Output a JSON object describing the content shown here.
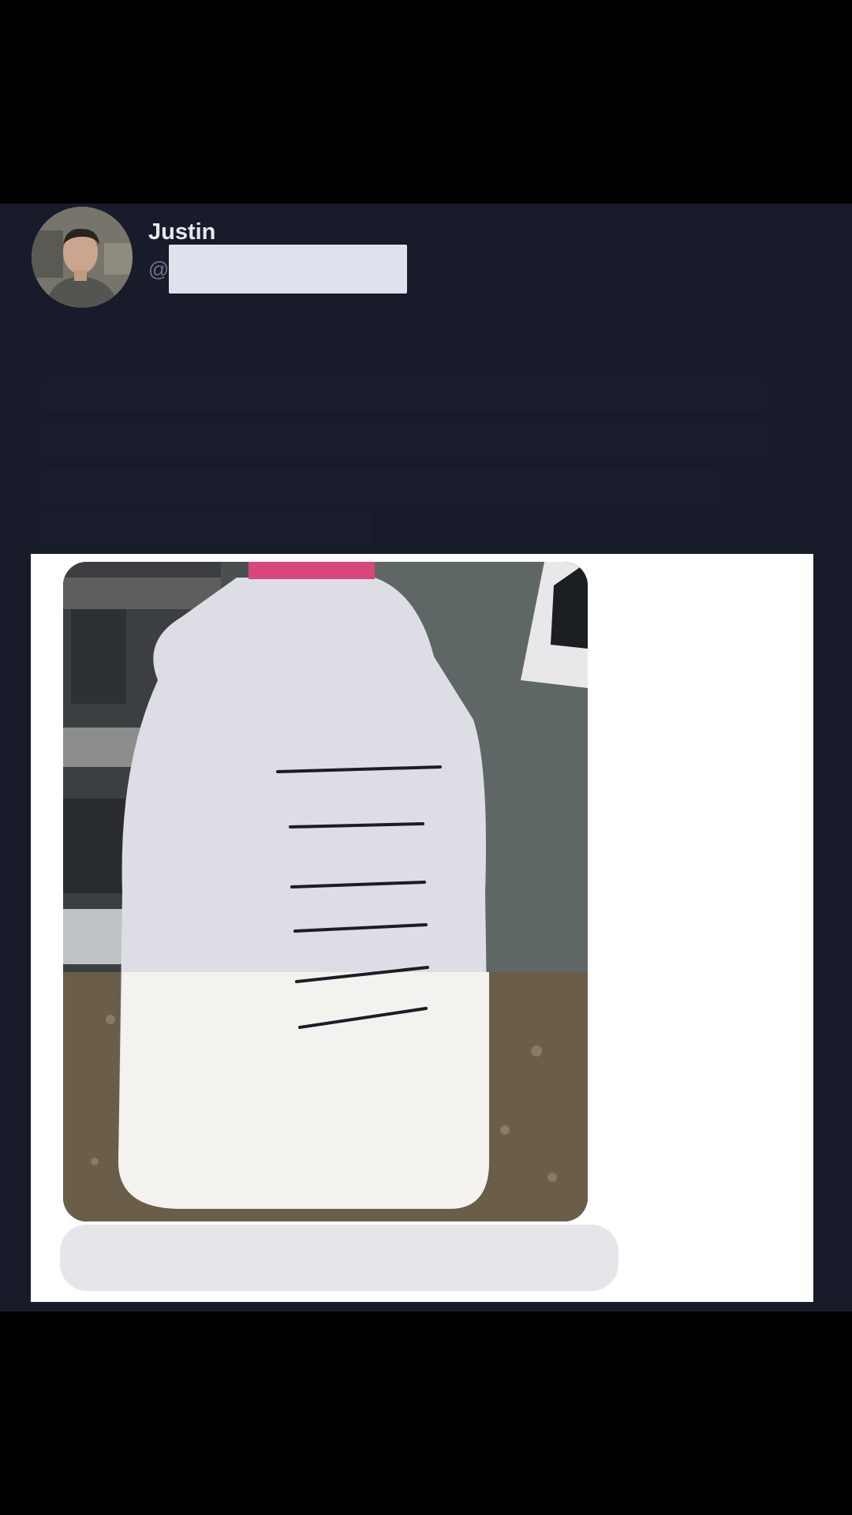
{
  "post": {
    "author": {
      "display_name": "Justin",
      "handle_prefix": "@"
    },
    "attachment": {
      "image_icon": "milk-jug-photo"
    }
  },
  "colors": {
    "background": "#181b2a",
    "display_name": "#e7e9ee",
    "handle": "#6e7486",
    "card": "#ffffff",
    "redaction": "#dfe1ec"
  }
}
